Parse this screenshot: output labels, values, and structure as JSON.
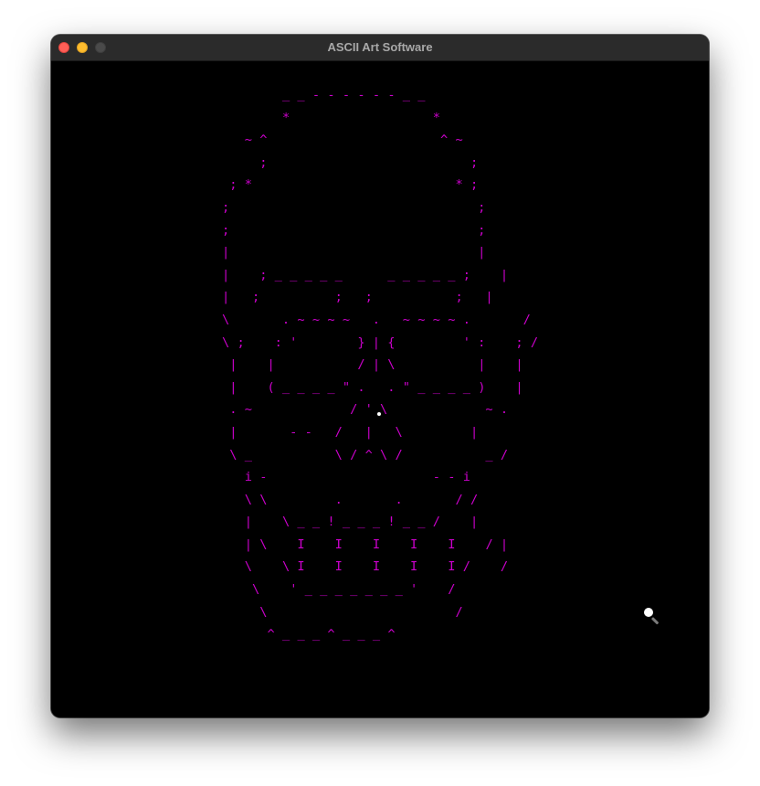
{
  "window": {
    "title": "ASCII Art Software",
    "buttons": {
      "close": "close-button",
      "minimize": "minimize-button",
      "zoom": "zoom-button"
    }
  },
  "canvas": {
    "background": "#000000",
    "art_color": "#cc00cc",
    "art": "     _ _ - - - - - - _ _\n   *                   *\n~ ^                       ^ ~\n;                           ;\n; *                           * ;\n;                                 ;\n;                                 ;\n|                                 |\n|    ; _ _ _ _ _      _ _ _ _ _ ;    |\n|   ;          ;   ;           ;   |\n\\       . ~ ~ ~ ~   .   ~ ~ ~ ~ .       /\n\\ ;    : '        } | {         ' :    ; /\n|    |           / | \\           |    |\n|    ( _ _ _ _ \" .   . \" _ _ _ _ )    |\n. ~             / ' \\             ~ .\n|       - -   /   |   \\         |\n\\ _           \\ / ^ \\ /           _ /\ni -                      - - i\n\\ \\         .       .       / /\n|    \\ _ _ ! _ _ _ ! _ _ /    |\n| \\    I    I    I    I    I    / |\n\\    \\ I    I    I    I    I /    /\n\\    ' _ _ _ _ _ _ _ '    /\n\\                         /\n^ _ _ _ ^ _ _ _ ^"
  }
}
